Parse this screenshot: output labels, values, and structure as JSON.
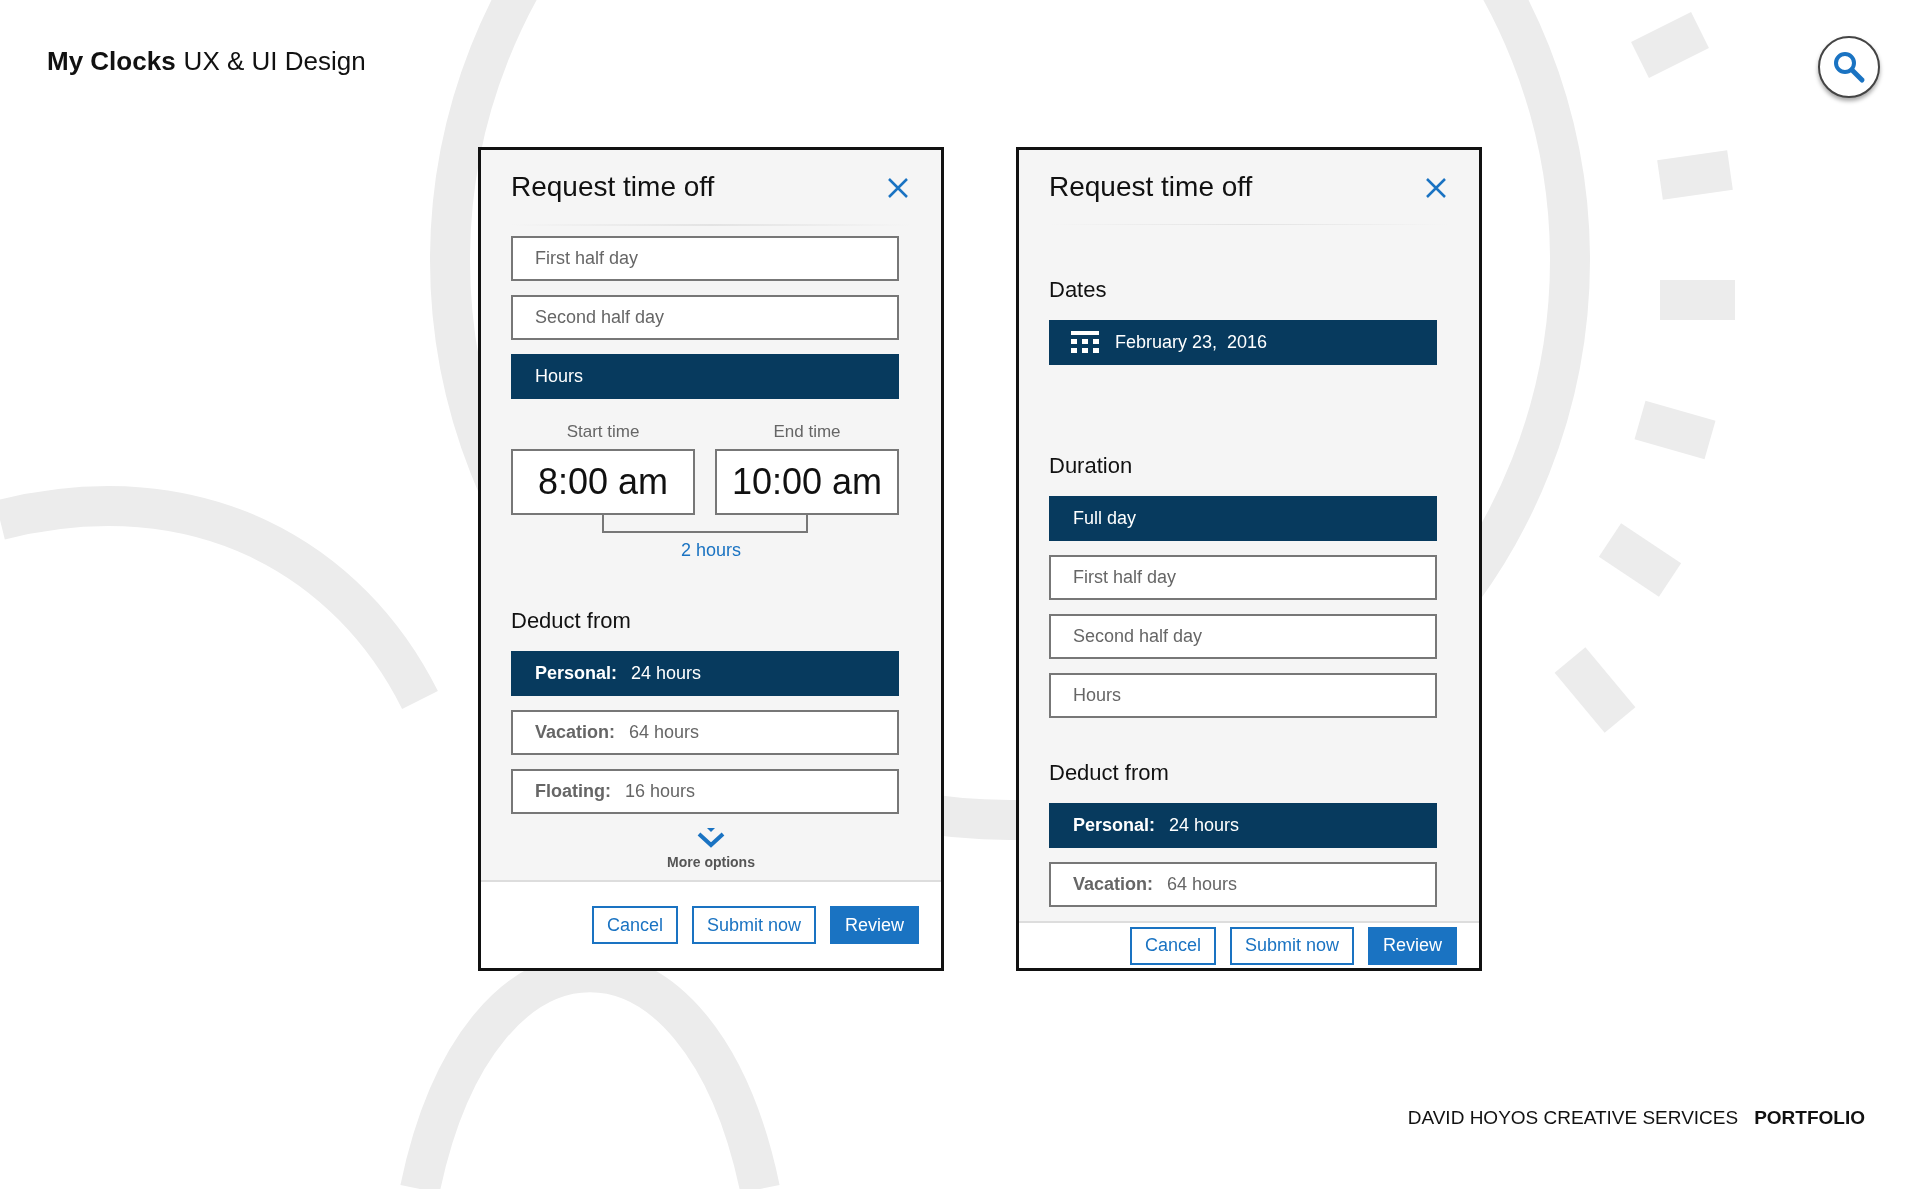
{
  "header": {
    "title": "My Clocks",
    "subtitle": "UX & UI Design"
  },
  "panels": [
    {
      "title": "Request time off",
      "sections": [
        {
          "kind": "options",
          "items": [
            {
              "label": "First half day",
              "selected": false
            },
            {
              "label": "Second half day",
              "selected": false
            },
            {
              "label": "Hours",
              "selected": true
            }
          ]
        },
        {
          "kind": "time_range",
          "start_label": "Start time",
          "start_value": "8:00 am",
          "end_label": "End time",
          "end_value": "10:00 am",
          "duration": "2 hours"
        },
        {
          "kind": "deduct",
          "heading": "Deduct from",
          "items": [
            {
              "name": "Personal:",
              "amount": "24 hours",
              "selected": true
            },
            {
              "name": "Vacation:",
              "amount": "64 hours",
              "selected": false
            },
            {
              "name": "Floating:",
              "amount": "16 hours",
              "selected": false
            }
          ]
        },
        {
          "kind": "more",
          "label": "More options"
        }
      ],
      "buttons": [
        {
          "label": "Cancel",
          "kind": "outline"
        },
        {
          "label": "Submit now",
          "kind": "outline"
        },
        {
          "label": "Review",
          "kind": "primary"
        }
      ]
    },
    {
      "title": "Request time off",
      "sections": [
        {
          "kind": "date",
          "heading": "Dates",
          "value": "February 23,  2016"
        },
        {
          "kind": "options",
          "heading": "Duration",
          "items": [
            {
              "label": "Full day",
              "selected": true
            },
            {
              "label": "First half day",
              "selected": false
            },
            {
              "label": "Second half day",
              "selected": false
            },
            {
              "label": "Hours",
              "selected": false
            }
          ]
        },
        {
          "kind": "deduct",
          "heading": "Deduct from",
          "items": [
            {
              "name": "Personal:",
              "amount": "24 hours",
              "selected": true
            },
            {
              "name": "Vacation:",
              "amount": "64 hours",
              "selected": false
            }
          ]
        }
      ],
      "buttons": [
        {
          "label": "Cancel",
          "kind": "outline"
        },
        {
          "label": "Submit now",
          "kind": "outline"
        },
        {
          "label": "Review",
          "kind": "primary"
        }
      ]
    }
  ],
  "footer": {
    "studio": "DAVID HOYOS CREATIVE SERVICES",
    "section": "PORTFOLIO"
  }
}
